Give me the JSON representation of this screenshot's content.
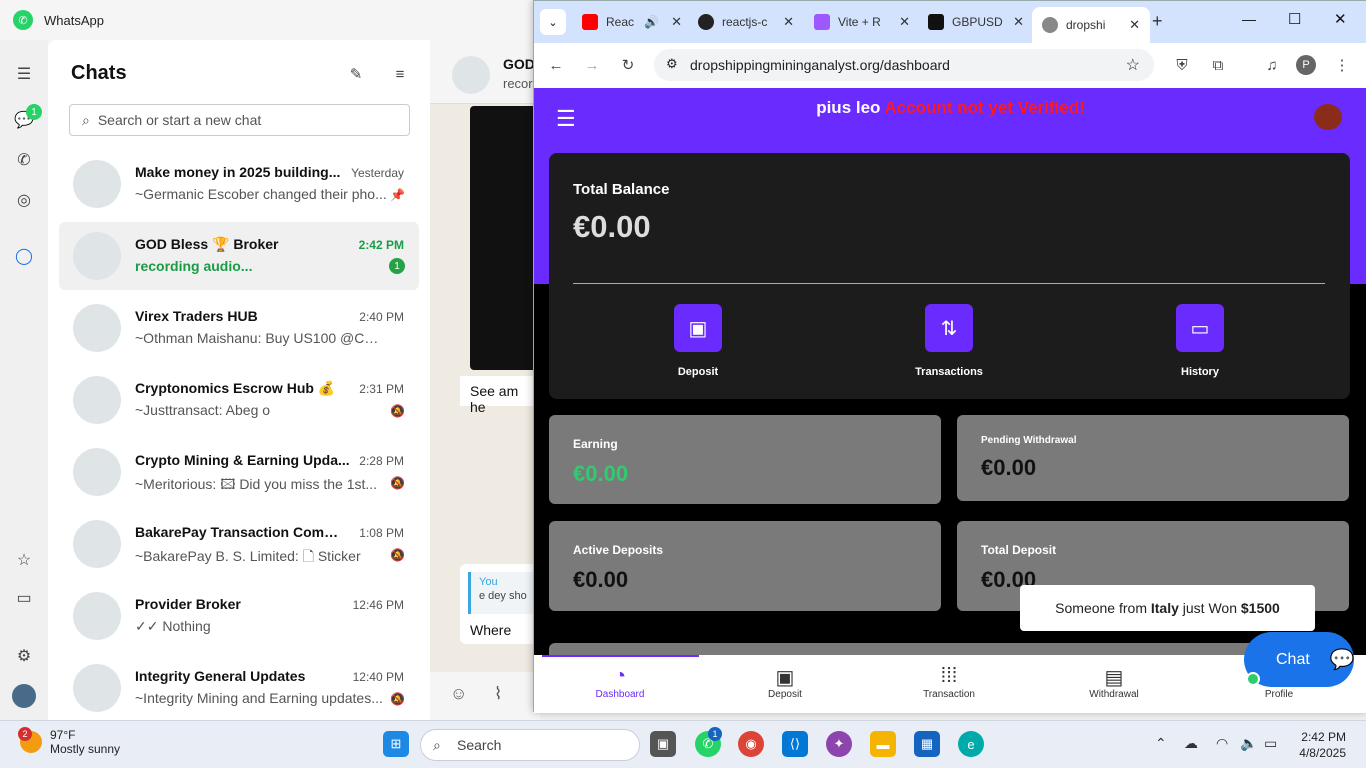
{
  "whatsapp": {
    "title": "WhatsApp",
    "chats_title": "Chats",
    "search_placeholder": "Search or start a new chat",
    "rail_badge": "1",
    "chats": [
      {
        "name": "Make money in 2025 building...",
        "time": "Yesterday",
        "preview": "~Germanic Escober changed their pho...",
        "status": "pinned"
      },
      {
        "name": "GOD Bless 🏆 Broker",
        "time": "2:42 PM",
        "preview": "recording audio...",
        "badge": "1"
      },
      {
        "name": "Virex Traders HUB",
        "time": "2:40 PM",
        "preview": "~Othman Maishanu: Buy US100 @CMP..."
      },
      {
        "name": "Cryptonomics Escrow Hub 💰",
        "time": "2:31 PM",
        "preview": "~Justtransact: Abeg o",
        "status": "muted"
      },
      {
        "name": "Crypto Mining & Earning Upda...",
        "time": "2:28 PM",
        "preview": "~Meritorious: 🖾 Did you miss the 1st...",
        "status": "muted"
      },
      {
        "name": "BakarePay Transaction Commu...",
        "time": "1:08 PM",
        "preview": "~BakarePay B. S. Limited: 🗋 Sticker",
        "status": "muted"
      },
      {
        "name": "Provider Broker",
        "time": "12:46 PM",
        "preview": "✓✓ Nothing"
      },
      {
        "name": "Integrity General Updates",
        "time": "12:40 PM",
        "preview": "~Integrity Mining and Earning updates...",
        "status": "muted"
      }
    ],
    "conversation": {
      "title": "GOD",
      "subtitle": "recor",
      "msg1": "See am he",
      "quote_you": "You",
      "quote_text": "e dey sho",
      "draft": "Where"
    }
  },
  "browser": {
    "tabs": [
      "Reac",
      "reactjs-c",
      "Vite + R",
      "GBPUSD",
      "dropshi"
    ],
    "url": "dropshippingmininganalyst.org/dashboard",
    "profile": "P"
  },
  "site": {
    "user": "pius leo",
    "warning": "Account not yet Verified!",
    "total_balance_label": "Total Balance",
    "total_balance": "€0.00",
    "actions": [
      "Deposit",
      "Transactions",
      "History"
    ],
    "stats": [
      {
        "label": "Earning",
        "value": "€0.00"
      },
      {
        "label": "Pending Withdrawal",
        "value": "€0.00"
      },
      {
        "label": "Active Deposits",
        "value": "€0.00"
      },
      {
        "label": "Total Deposit",
        "value": "€0.00"
      }
    ],
    "notif_pre": "Someone from ",
    "notif_country": "Italy",
    "notif_mid": " just Won ",
    "notif_amount": "$1500",
    "chat_label": "Chat",
    "nav": [
      "Dashboard",
      "Deposit",
      "Transaction",
      "Withdrawal",
      "Profile"
    ],
    "accent": "#6a2bff",
    "earning_color": "#2ecc71"
  },
  "taskbar": {
    "weather_temp": "97°F",
    "weather_desc": "Mostly sunny",
    "weather_badge": "2",
    "search": "Search",
    "wa_badge": "1",
    "time": "2:42 PM",
    "date": "4/8/2025"
  }
}
